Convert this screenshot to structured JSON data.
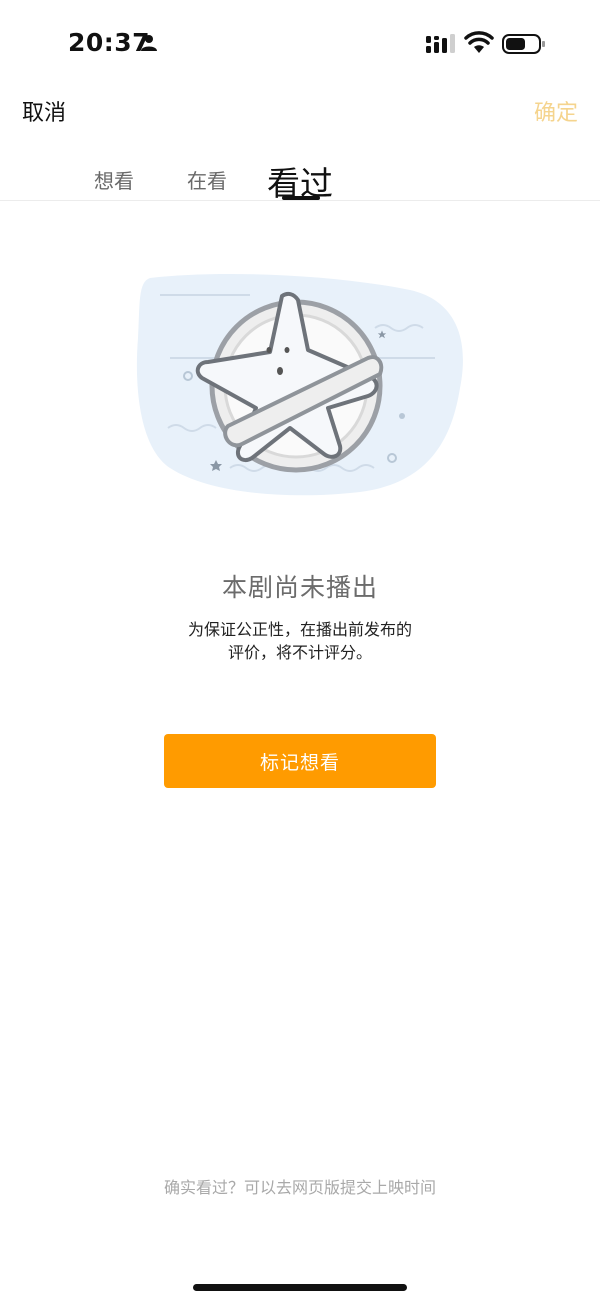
{
  "status_bar": {
    "time": "20:37",
    "icons": [
      "person-icon",
      "signal-icon",
      "wifi-icon",
      "battery-icon"
    ]
  },
  "nav": {
    "cancel_label": "取消",
    "confirm_label": "确定"
  },
  "tabs": [
    {
      "label": "想看",
      "active": false
    },
    {
      "label": "在看",
      "active": false
    },
    {
      "label": "看过",
      "active": true
    }
  ],
  "empty_state": {
    "illustration": "ghost-prohibited-illustration",
    "title": "本剧尚未播出",
    "description_line1": "为保证公正性，在播出前发布的",
    "description_line2": "评价，将不计评分。",
    "button_label": "标记想看"
  },
  "footer": {
    "link_text": "确实看过？可以去网页版提交上映时间"
  },
  "colors": {
    "accent": "#ff9b00",
    "confirm_disabled": "#f5d48e",
    "muted_text": "#a9a9a9"
  }
}
